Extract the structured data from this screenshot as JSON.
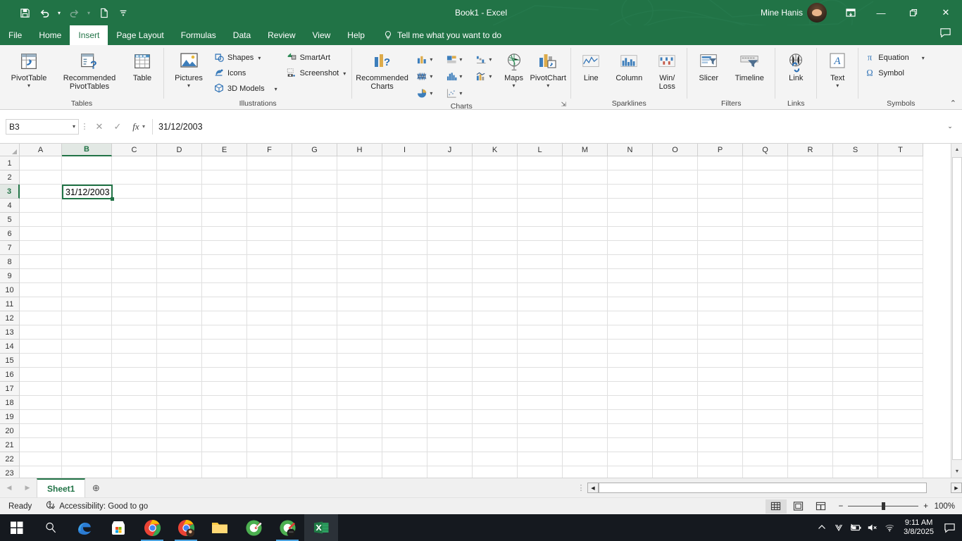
{
  "window": {
    "title": "Book1  -  Excel",
    "user_name": "Mine Hanis",
    "minimize": "—",
    "restore": "❐",
    "close": "✕"
  },
  "quick_access": [
    {
      "name": "save",
      "glyph": "💾"
    },
    {
      "name": "undo",
      "glyph": "↶"
    },
    {
      "name": "redo",
      "glyph": "↷"
    },
    {
      "name": "new",
      "glyph": "🗋"
    },
    {
      "name": "customize",
      "glyph": "≡"
    }
  ],
  "tabs": [
    {
      "label": "File",
      "active": false
    },
    {
      "label": "Home",
      "active": false
    },
    {
      "label": "Insert",
      "active": true
    },
    {
      "label": "Page Layout",
      "active": false
    },
    {
      "label": "Formulas",
      "active": false
    },
    {
      "label": "Data",
      "active": false
    },
    {
      "label": "Review",
      "active": false
    },
    {
      "label": "View",
      "active": false
    },
    {
      "label": "Help",
      "active": false
    }
  ],
  "tell_me": "Tell me what you want to do",
  "ribbon": {
    "groups": {
      "tables": {
        "label": "Tables",
        "pivot_table": "PivotTable",
        "recommended_pivot_tables": "Recommended\nPivotTables",
        "recommended_pivot_tables_l1": "Recommended",
        "recommended_pivot_tables_l2": "PivotTables",
        "table": "Table"
      },
      "illustrations": {
        "label": "Illustrations",
        "pictures": "Pictures",
        "shapes": "Shapes",
        "icons": "Icons",
        "models_3d": "3D Models",
        "smartart": "SmartArt",
        "screenshot": "Screenshot"
      },
      "charts": {
        "label": "Charts",
        "recommended_charts_l1": "Recommended",
        "recommended_charts_l2": "Charts",
        "maps": "Maps",
        "pivotchart": "PivotChart",
        "types": [
          "column-chart",
          "treemap-chart",
          "waterfall-chart",
          "stock-chart",
          "histogram-chart",
          "combo-chart",
          "pie-chart",
          "scatter-chart"
        ]
      },
      "sparklines": {
        "label": "Sparklines",
        "line": "Line",
        "column": "Column",
        "win_loss_l1": "Win/",
        "win_loss_l2": "Loss"
      },
      "filters": {
        "label": "Filters",
        "slicer": "Slicer",
        "timeline": "Timeline"
      },
      "links": {
        "label": "Links",
        "link": "Link"
      },
      "text": {
        "label": "",
        "text": "Text"
      },
      "symbols": {
        "label": "Symbols",
        "equation": "Equation",
        "symbol": "Symbol"
      }
    },
    "collapse_glyph": "⌃"
  },
  "formula_bar": {
    "name_box": "B3",
    "cancel_glyph": "✕",
    "enter_glyph": "✓",
    "fx_label": "fx",
    "value": "31/12/2003",
    "expand_glyph": "⌄"
  },
  "grid": {
    "columns": [
      "A",
      "B",
      "C",
      "D",
      "E",
      "F",
      "G",
      "H",
      "I",
      "J",
      "K",
      "L",
      "M",
      "N",
      "O",
      "P",
      "Q",
      "R",
      "S",
      "T"
    ],
    "selected_column": "B",
    "rows": [
      1,
      2,
      3,
      4,
      5,
      6,
      7,
      8,
      9,
      10,
      11,
      12,
      13,
      14,
      15,
      16,
      17,
      18,
      19,
      20,
      21,
      22,
      23
    ],
    "selected_row": 3,
    "selected_cell": "B3",
    "cell_value": "31/12/2003"
  },
  "sheet_bar": {
    "prev_glyph": "◀",
    "next_glyph": "▶",
    "sheets": [
      {
        "label": "Sheet1",
        "active": true
      }
    ],
    "add_glyph": "⊕"
  },
  "status_bar": {
    "state": "Ready",
    "accessibility": "Accessibility: Good to go",
    "views": [
      {
        "name": "normal-view",
        "active": true
      },
      {
        "name": "page-layout-view",
        "active": false
      },
      {
        "name": "page-break-view",
        "active": false
      }
    ],
    "zoom_out": "−",
    "zoom_in": "+",
    "zoom_level": "100%"
  },
  "taskbar": {
    "items": [
      {
        "name": "start-button"
      },
      {
        "name": "search-button"
      },
      {
        "name": "edge-app"
      },
      {
        "name": "microsoft-store-app"
      },
      {
        "name": "chrome-app"
      },
      {
        "name": "chrome-profile-app"
      },
      {
        "name": "file-explorer-app"
      },
      {
        "name": "green-app-1"
      },
      {
        "name": "green-app-2"
      },
      {
        "name": "excel-app"
      }
    ],
    "tray": {
      "chevron": "⌃",
      "v_icon": "V",
      "battery": "battery-charging-icon",
      "volume": "volume-muted-icon",
      "network": "wifi-icon",
      "time": "9:11 AM",
      "date": "3/8/2025",
      "notification": "notification-icon"
    }
  },
  "colors": {
    "excel_green": "#217346",
    "ribbon_bg": "#f4f4f4",
    "accent_blue": "#4472c4",
    "accent_gold": "#ddab4a"
  }
}
